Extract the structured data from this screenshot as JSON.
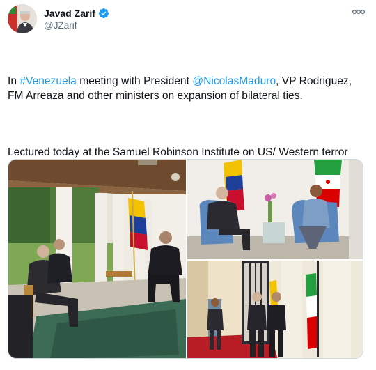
{
  "author": {
    "display_name": "Javad Zarif",
    "handle": "@JZarif",
    "avatar_icon": "profile-avatar",
    "verified_icon": "verified-badge-icon",
    "verified_color": "#1d9bf0"
  },
  "menu": {
    "icon": "more-dots-icon"
  },
  "text": {
    "p1_a": "In ",
    "p1_hashtag": "#Venezuela",
    "p1_b": " meeting with President ",
    "p1_mention": "@NicolasMaduro",
    "p1_c": ", VP Rodriguez, FM Arreaza and other ministers on expansion of bilateral ties.",
    "p2": "Lectured today at the Samuel Robinson Institute on US/ Western terror tactics in attempts to halt the course of history toward a post-Western world."
  },
  "colors": {
    "link": "#1d9bf0",
    "text": "#0f1419",
    "secondary": "#536471"
  },
  "media": [
    {
      "name": "photo-veranda-meeting"
    },
    {
      "name": "photo-seated-flags-meeting"
    },
    {
      "name": "photo-hallway-flags"
    }
  ]
}
